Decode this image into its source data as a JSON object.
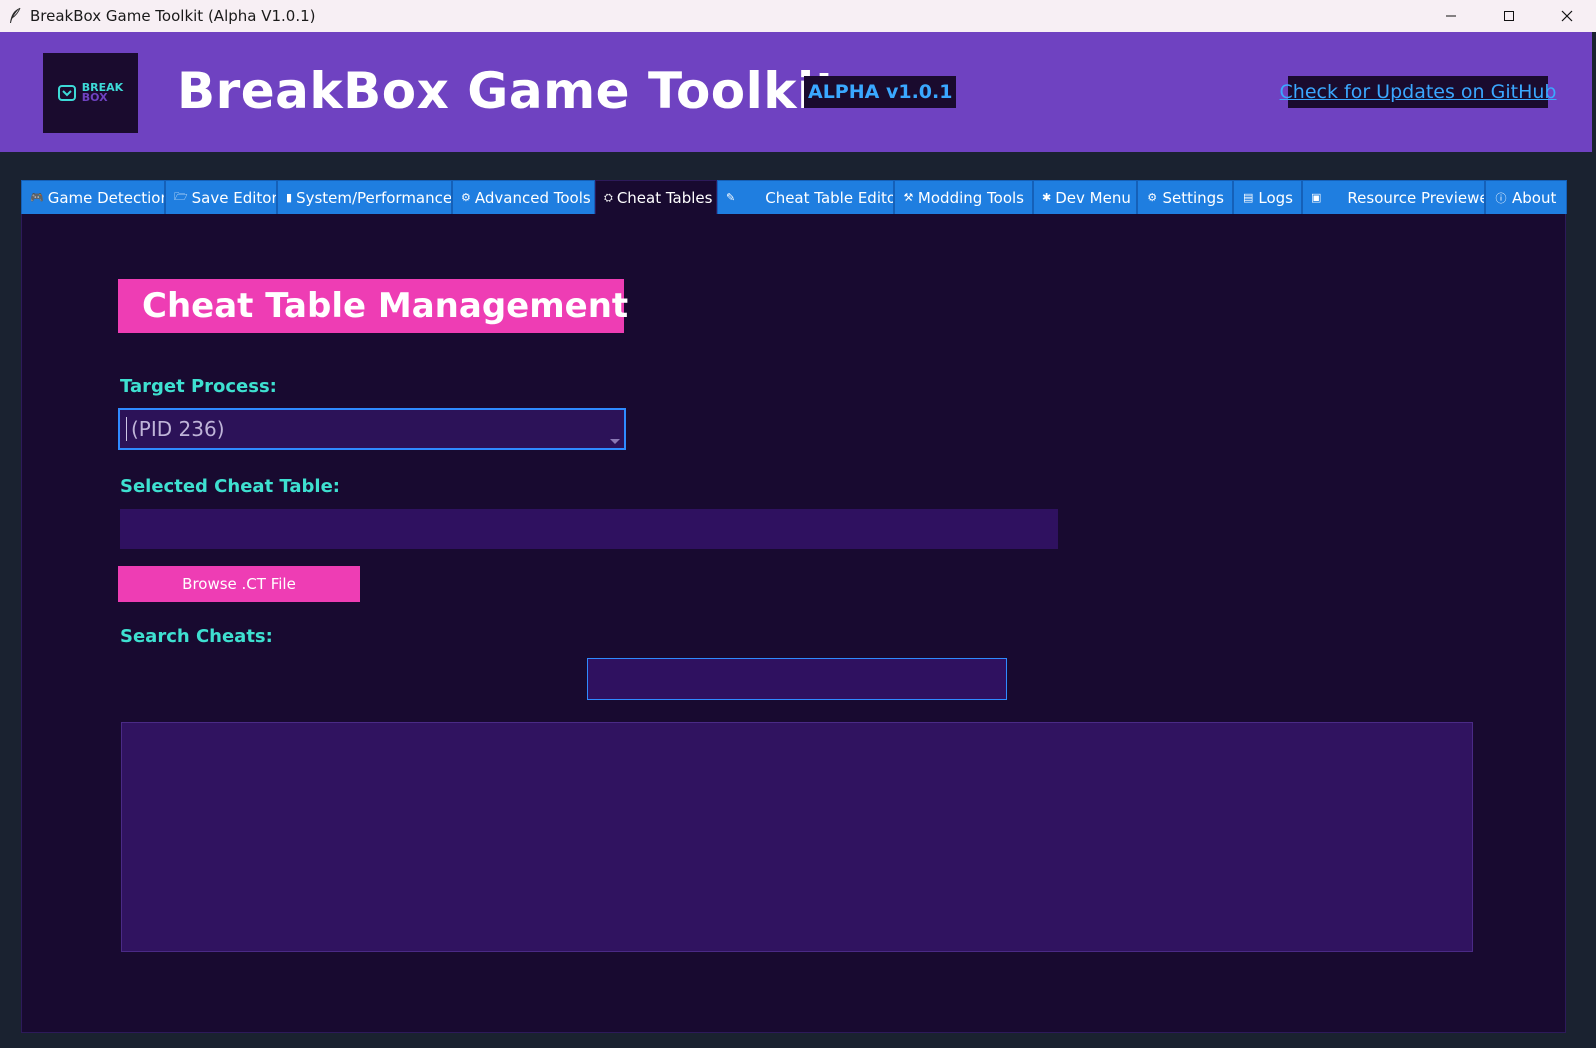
{
  "window": {
    "title": "BreakBox Game Toolkit (Alpha V1.0.1)",
    "controls": [
      "minimize",
      "maximize",
      "close"
    ]
  },
  "header": {
    "logo_line1": "BREAK",
    "logo_line2": "BOX",
    "title": "BreakBox Game Toolkit",
    "version_badge": "ALPHA v1.0.1",
    "update_link": "Check for Updates on GitHub"
  },
  "tabs": [
    {
      "label": "Game Detection",
      "icon": "gamepad-icon"
    },
    {
      "label": "Save Editor",
      "icon": "folder-icon"
    },
    {
      "label": "System/Performance",
      "icon": "chart-icon"
    },
    {
      "label": "Advanced Tools",
      "icon": "gear-icon"
    },
    {
      "label": "Cheat Tables",
      "icon": "cheat-icon",
      "active": true
    },
    {
      "label": "Cheat Table Editor",
      "icon": "pencil-icon"
    },
    {
      "label": "Modding Tools",
      "icon": "wrench-icon"
    },
    {
      "label": "Dev Menu",
      "icon": "bug-icon"
    },
    {
      "label": "Settings",
      "icon": "settings-icon"
    },
    {
      "label": "Logs",
      "icon": "scroll-icon"
    },
    {
      "label": "Resource Previewer",
      "icon": "image-icon"
    },
    {
      "label": "About",
      "icon": "info-icon"
    }
  ],
  "cheat_tables": {
    "section_title": "Cheat Table Management",
    "target_process_label": "Target Process:",
    "target_process_value": "(PID 236)",
    "selected_table_label": "Selected Cheat Table:",
    "selected_table_value": "",
    "browse_button": "Browse .CT File",
    "search_label": "Search Cheats:",
    "search_value": ""
  },
  "colors": {
    "header_bg": "#6f42c1",
    "panel_bg": "#180a30",
    "accent_pink": "#ee3db4",
    "accent_teal": "#3ee0d0",
    "tab_blue": "#1f7ee0",
    "link_blue": "#3aa8ff"
  }
}
